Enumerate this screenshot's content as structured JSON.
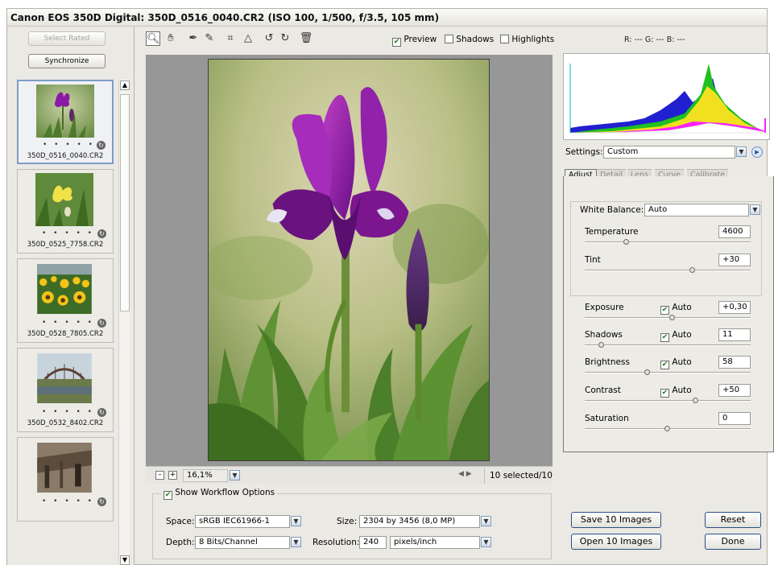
{
  "window": {
    "title": "Canon EOS 350D Digital:  350D_0516_0040.CR2  (ISO 100, 1/500, f/3.5, 105 mm)"
  },
  "filmstrip": {
    "select_rated_label": "Select Rated",
    "synchronize_label": "Synchronize",
    "thumbnails": [
      {
        "name": "350D_0516_0040.CR2",
        "dots": "• • • • •",
        "selected": true
      },
      {
        "name": "350D_0525_7758.CR2",
        "dots": "• • • • •",
        "selected": false
      },
      {
        "name": "350D_0528_7805.CR2",
        "dots": "• • • • •",
        "selected": false
      },
      {
        "name": "350D_0532_8402.CR2",
        "dots": "• • • • •",
        "selected": false
      },
      {
        "name": "",
        "dots": "• • • • •",
        "selected": false
      }
    ]
  },
  "toolbar": {
    "tools": [
      "zoom-tool-icon",
      "hand-tool-icon",
      "white-balance-tool-icon",
      "color-sampler-tool-icon",
      "crop-tool-icon",
      "straighten-tool-icon",
      "rotate-left-icon",
      "rotate-right-icon",
      "trash-icon"
    ],
    "preview": {
      "label": "Preview",
      "checked": true
    },
    "shadows": {
      "label": "Shadows",
      "checked": false
    },
    "highlights": {
      "label": "Highlights",
      "checked": false
    },
    "rgb_readout": "R: ---   G: ---   B: ---"
  },
  "preview": {
    "zoom_value": "16,1%",
    "selection_count": "10 selected/10"
  },
  "workflow": {
    "show_label": "Show Workflow Options",
    "checked": true,
    "space_label": "Space:",
    "space_value": "sRGB IEC61966-1",
    "size_label": "Size:",
    "size_value": "2304 by 3456  (8,0 MP)",
    "depth_label": "Depth:",
    "depth_value": "8 Bits/Channel",
    "resolution_label": "Resolution:",
    "resolution_value": "240",
    "resolution_unit": "pixels/inch"
  },
  "settings": {
    "label": "Settings:",
    "value": "Custom",
    "tabs": [
      "Adjust",
      "Detail",
      "Lens",
      "Curve",
      "Calibrate"
    ],
    "active_tab": "Adjust",
    "white_balance_label": "White Balance:",
    "white_balance_value": "Auto",
    "sliders": [
      {
        "label": "Temperature",
        "value": "4600",
        "auto": false,
        "level": 0.25
      },
      {
        "label": "Tint",
        "value": "+30",
        "auto": false,
        "level": 0.65
      },
      {
        "label": "Exposure",
        "value": "+0,30",
        "auto": true,
        "auto_label": "Auto",
        "level": 0.53
      },
      {
        "label": "Shadows",
        "value": "11",
        "auto": true,
        "auto_label": "Auto",
        "level": 0.1
      },
      {
        "label": "Brightness",
        "value": "58",
        "auto": true,
        "auto_label": "Auto",
        "level": 0.38
      },
      {
        "label": "Contrast",
        "value": "+50",
        "auto": true,
        "auto_label": "Auto",
        "level": 0.67
      },
      {
        "label": "Saturation",
        "value": "0",
        "auto": false,
        "level": 0.5
      }
    ]
  },
  "actions": {
    "save_label": "Save 10 Images",
    "open_label": "Open 10 Images",
    "reset_label": "Reset",
    "done_label": "Done"
  },
  "colors": {
    "chrome_bg": "#ebe9e3",
    "preview_bg": "#979797",
    "selection_border": "#7d9cc6",
    "iris_purple": "#8b1aa6"
  }
}
